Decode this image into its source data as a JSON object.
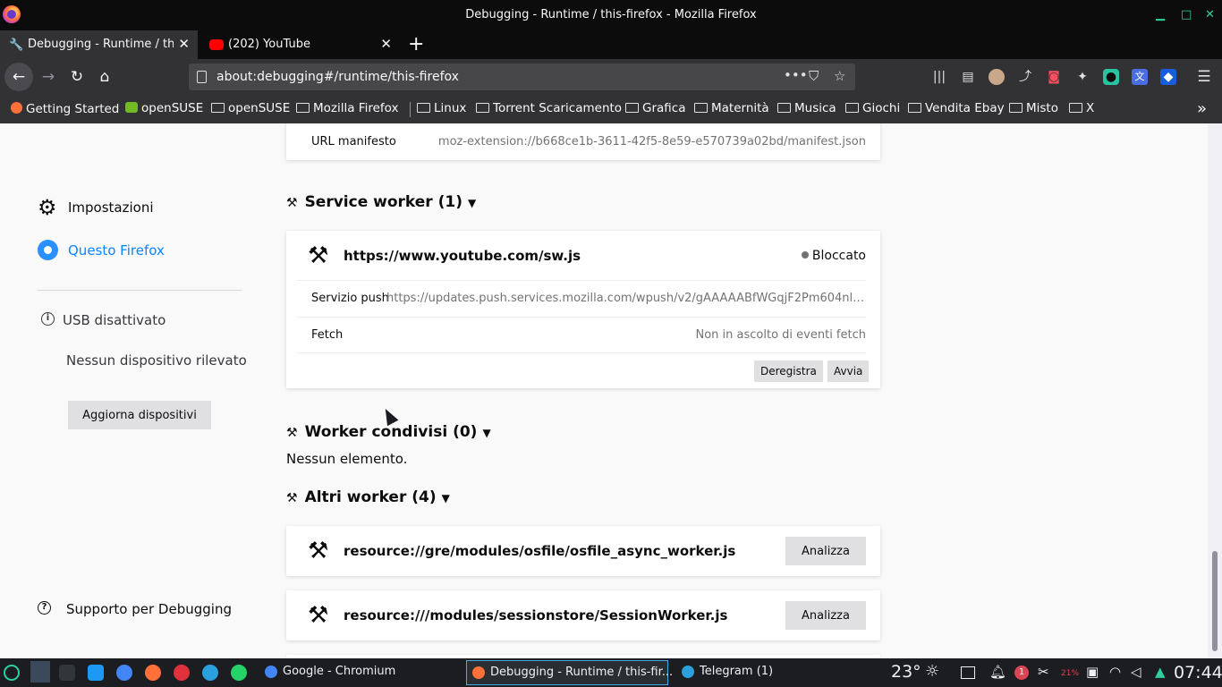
{
  "window": {
    "title": "Debugging - Runtime / this-firefox - Mozilla Firefox",
    "minimize": "▁",
    "maximize": "□",
    "close": "✕"
  },
  "tabs": [
    {
      "title": "Debugging - Runtime / thi",
      "icon": "wrench-icon"
    },
    {
      "title": "(202) YouTube",
      "icon": "youtube-icon"
    }
  ],
  "toolbar": {
    "url": "about:debugging#/runtime/this-firefox",
    "new_tab": "+",
    "page_actions": "•••"
  },
  "bookmarks": [
    "Getting Started",
    "openSUSE",
    "openSUSE",
    "Mozilla Firefox",
    "Linux",
    "Torrent Scaricamento",
    "Grafica",
    "Maternità",
    "Musica",
    "Giochi",
    "Vendita Ebay",
    "Misto",
    "X"
  ],
  "sidebar": {
    "settings": "Impostazioni",
    "this_firefox": "Questo Firefox",
    "usb_status": "USB disattivato",
    "no_devices": "Nessun dispositivo rilevato",
    "refresh_button": "Aggiorna dispositivi",
    "support": "Supporto per Debugging"
  },
  "manifest": {
    "label": "URL manifesto",
    "url": "moz-extension://b668ce1b-3611-42f5-8e59-e570739a02bd/manifest.json"
  },
  "service_workers": {
    "header": "Service worker (1)",
    "worker": {
      "url": "https://www.youtube.com/sw.js",
      "status": "Bloccato",
      "push_label": "Servizio push",
      "push_value": "https://updates.push.services.mozilla.com/wpush/v2/gAAAAABfWGqjF2Pm604nlQWG...",
      "fetch_label": "Fetch",
      "fetch_value": "Non in ascolto di eventi fetch",
      "unregister_button": "Deregistra",
      "start_button": "Avvia"
    }
  },
  "shared_workers": {
    "header": "Worker condivisi (0)",
    "empty": "Nessun elemento."
  },
  "other_workers": {
    "header": "Altri worker (4)",
    "items": [
      {
        "name": "resource://gre/modules/osfile/osfile_async_worker.js",
        "button": "Analizza"
      },
      {
        "name": "resource:///modules/sessionstore/SessionWorker.js",
        "button": "Analizza"
      }
    ]
  },
  "taskbar": {
    "tasks": [
      {
        "label": "Google - Chromium"
      },
      {
        "label": "Debugging - Runtime / this-fir..."
      },
      {
        "label": "Telegram (1)"
      }
    ],
    "temperature": "23°",
    "battery": "21%",
    "notification_count": "1",
    "clock": "07:44"
  },
  "colors": {
    "accent": "#0a84ff",
    "chrome_dark": "#0c0c0d",
    "toolbar": "#323234",
    "page_bg": "#f9f9fa",
    "taskbar": "#1b1d20"
  }
}
